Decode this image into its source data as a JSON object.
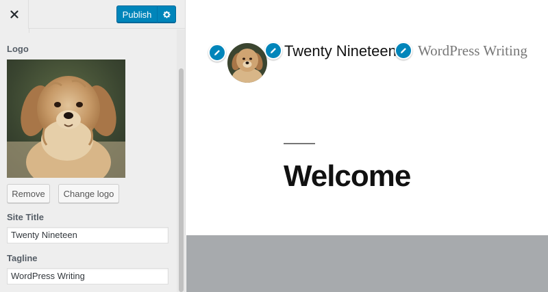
{
  "toolbar": {
    "close_icon": "close-icon",
    "publish_label": "Publish",
    "settings_icon": "gear-icon",
    "accent": "#0085ba"
  },
  "panel": {
    "logo": {
      "heading": "Logo",
      "remove_label": "Remove",
      "change_label": "Change logo"
    },
    "site_title": {
      "heading": "Site Title",
      "value": "Twenty Nineteen"
    },
    "tagline": {
      "heading": "Tagline",
      "value": "WordPress Writing"
    }
  },
  "preview": {
    "site_title": "Twenty Nineteen",
    "tagline": "WordPress Writing",
    "edit_icon": "pencil-icon",
    "heading": "Welcome"
  }
}
